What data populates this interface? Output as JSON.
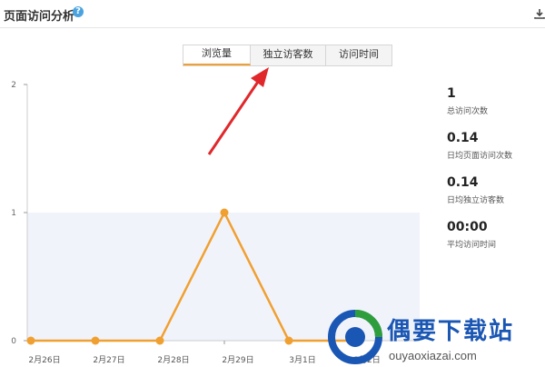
{
  "header": {
    "title": "页面访问分析",
    "help_glyph": "?"
  },
  "tabs": [
    {
      "label": "浏览量",
      "active": true
    },
    {
      "label": "独立访客数",
      "active": false
    },
    {
      "label": "访问时间",
      "active": false
    }
  ],
  "chart_data": {
    "type": "line",
    "categories": [
      "2月26日",
      "2月27日",
      "2月28日",
      "2月29日",
      "3月1日",
      "3月2日"
    ],
    "values": [
      0,
      0,
      0,
      1,
      0,
      0
    ],
    "ylim": [
      0,
      2
    ],
    "yticks": [
      0,
      1,
      2
    ],
    "color": "#f0a030",
    "band_color": "#f1f3fb"
  },
  "stats": [
    {
      "value": "1",
      "label": "总访问次数"
    },
    {
      "value": "0.14",
      "label": "日均页面访问次数"
    },
    {
      "value": "0.14",
      "label": "日均独立访客数"
    },
    {
      "value": "00:00",
      "label": "平均访问时间"
    }
  ],
  "watermark": {
    "name": "偶要下载站",
    "url": "ouyaoxiazai.com"
  },
  "colors": {
    "accent": "#f0a030",
    "annotation_arrow": "#e0282c",
    "help_icon": "#4aa3df"
  }
}
